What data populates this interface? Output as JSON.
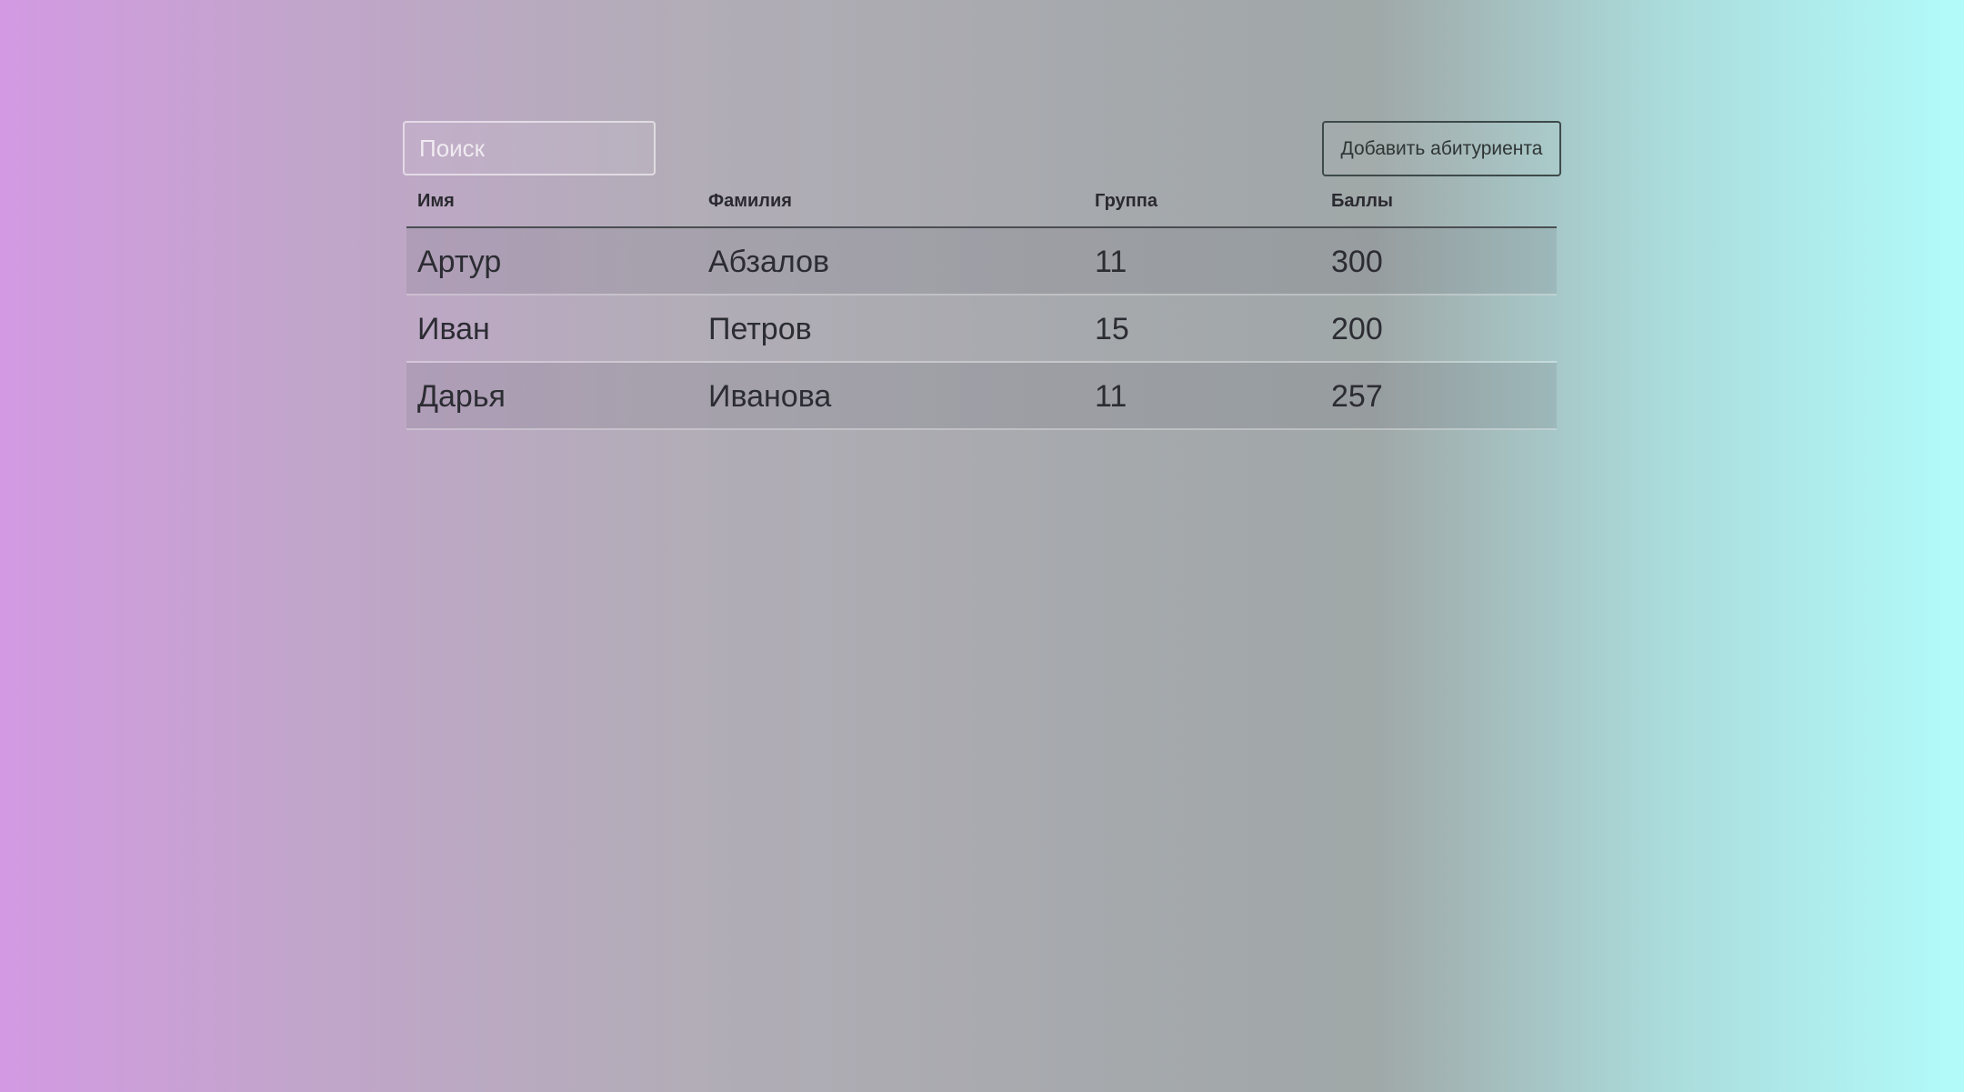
{
  "search": {
    "placeholder": "Поиск"
  },
  "toolbar": {
    "add_label": "Добавить абитуриента"
  },
  "table": {
    "headers": [
      "Имя",
      "Фамилия",
      "Группа",
      "Баллы"
    ],
    "rows": [
      [
        "Артур",
        "Абзалов",
        "11",
        "300"
      ],
      [
        "Иван",
        "Петров",
        "15",
        "200"
      ],
      [
        "Дарья",
        "Иванова",
        "11",
        "257"
      ]
    ]
  }
}
